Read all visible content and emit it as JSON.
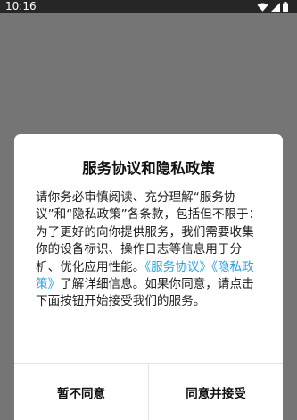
{
  "status_bar": {
    "time": "10:16",
    "icons": [
      "wifi-icon",
      "cell-signal-icon",
      "battery-icon"
    ]
  },
  "dialog": {
    "title": "服务协议和隐私政策",
    "body_intro": "请你务必审慎阅读、充分理解“服务协议”和“隐私政策”各条款，包括但不限于：为了更好的向你提供服务，我们需要收集你的设备标识、操作日志等信息用于分析、优化应用性能。",
    "link_service": "《服务协议》",
    "link_privacy": "《隐私政策》",
    "body_outro": "了解详细信息。如果你同意，请点击下面按钮开始接受我们的服务。",
    "decline_label": "暂不同意",
    "accept_label": "同意并接受"
  },
  "colors": {
    "link": "#29a3de",
    "scrim": "#757575",
    "status_bar": "#262626"
  }
}
